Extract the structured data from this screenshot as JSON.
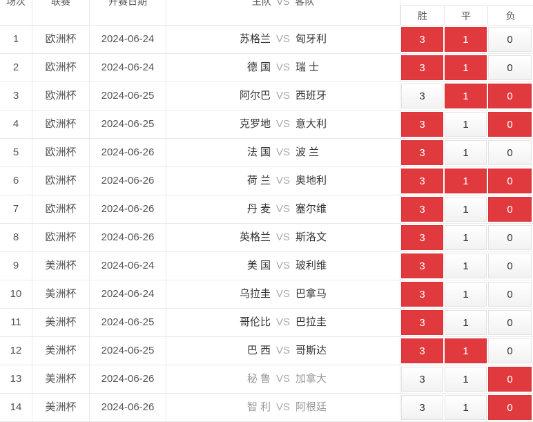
{
  "header": {
    "col_index": "场次",
    "col_league": "联赛",
    "col_date": "开赛日期",
    "col_match_home": "主队",
    "col_match_vs": "VS",
    "col_match_away": "客队",
    "col_win": "胜",
    "col_draw": "平",
    "col_lose": "负"
  },
  "colors": {
    "selected": "#e03a3e",
    "muted_text": "#999999"
  },
  "rows": [
    {
      "idx": "1",
      "league": "欧洲杯",
      "date": "2024-06-24",
      "home": "苏格兰",
      "vs": "VS",
      "away": "匈牙利",
      "w": "3",
      "d": "1",
      "l": "0",
      "sel": [
        true,
        true,
        false
      ],
      "muted": false
    },
    {
      "idx": "2",
      "league": "欧洲杯",
      "date": "2024-06-24",
      "home": "德 国",
      "vs": "VS",
      "away": "瑞 士",
      "w": "3",
      "d": "1",
      "l": "0",
      "sel": [
        true,
        true,
        false
      ],
      "muted": false
    },
    {
      "idx": "3",
      "league": "欧洲杯",
      "date": "2024-06-25",
      "home": "阿尔巴",
      "vs": "VS",
      "away": "西班牙",
      "w": "3",
      "d": "1",
      "l": "0",
      "sel": [
        false,
        true,
        true
      ],
      "muted": false
    },
    {
      "idx": "4",
      "league": "欧洲杯",
      "date": "2024-06-25",
      "home": "克罗地",
      "vs": "VS",
      "away": "意大利",
      "w": "3",
      "d": "1",
      "l": "0",
      "sel": [
        true,
        false,
        true
      ],
      "muted": false
    },
    {
      "idx": "5",
      "league": "欧洲杯",
      "date": "2024-06-26",
      "home": "法 国",
      "vs": "VS",
      "away": "波 兰",
      "w": "3",
      "d": "1",
      "l": "0",
      "sel": [
        true,
        false,
        false
      ],
      "muted": false
    },
    {
      "idx": "6",
      "league": "欧洲杯",
      "date": "2024-06-26",
      "home": "荷 兰",
      "vs": "VS",
      "away": "奥地利",
      "w": "3",
      "d": "1",
      "l": "0",
      "sel": [
        true,
        true,
        true
      ],
      "muted": false
    },
    {
      "idx": "7",
      "league": "欧洲杯",
      "date": "2024-06-26",
      "home": "丹 麦",
      "vs": "VS",
      "away": "塞尔维",
      "w": "3",
      "d": "1",
      "l": "0",
      "sel": [
        true,
        false,
        true
      ],
      "muted": false
    },
    {
      "idx": "8",
      "league": "欧洲杯",
      "date": "2024-06-26",
      "home": "英格兰",
      "vs": "VS",
      "away": "斯洛文",
      "w": "3",
      "d": "1",
      "l": "0",
      "sel": [
        true,
        false,
        false
      ],
      "muted": false
    },
    {
      "idx": "9",
      "league": "美洲杯",
      "date": "2024-06-24",
      "home": "美 国",
      "vs": "VS",
      "away": "玻利维",
      "w": "3",
      "d": "1",
      "l": "0",
      "sel": [
        true,
        false,
        false
      ],
      "muted": false
    },
    {
      "idx": "10",
      "league": "美洲杯",
      "date": "2024-06-24",
      "home": "乌拉圭",
      "vs": "VS",
      "away": "巴拿马",
      "w": "3",
      "d": "1",
      "l": "0",
      "sel": [
        true,
        false,
        false
      ],
      "muted": false
    },
    {
      "idx": "11",
      "league": "美洲杯",
      "date": "2024-06-25",
      "home": "哥伦比",
      "vs": "VS",
      "away": "巴拉圭",
      "w": "3",
      "d": "1",
      "l": "0",
      "sel": [
        true,
        false,
        false
      ],
      "muted": false
    },
    {
      "idx": "12",
      "league": "美洲杯",
      "date": "2024-06-25",
      "home": "巴 西",
      "vs": "VS",
      "away": "哥斯达",
      "w": "3",
      "d": "1",
      "l": "0",
      "sel": [
        true,
        true,
        false
      ],
      "muted": false
    },
    {
      "idx": "13",
      "league": "美洲杯",
      "date": "2024-06-26",
      "home": "秘 鲁",
      "vs": "VS",
      "away": "加拿大",
      "w": "3",
      "d": "1",
      "l": "0",
      "sel": [
        false,
        false,
        true
      ],
      "muted": true
    },
    {
      "idx": "14",
      "league": "美洲杯",
      "date": "2024-06-26",
      "home": "智 利",
      "vs": "VS",
      "away": "阿根廷",
      "w": "3",
      "d": "1",
      "l": "0",
      "sel": [
        false,
        false,
        true
      ],
      "muted": true
    }
  ]
}
